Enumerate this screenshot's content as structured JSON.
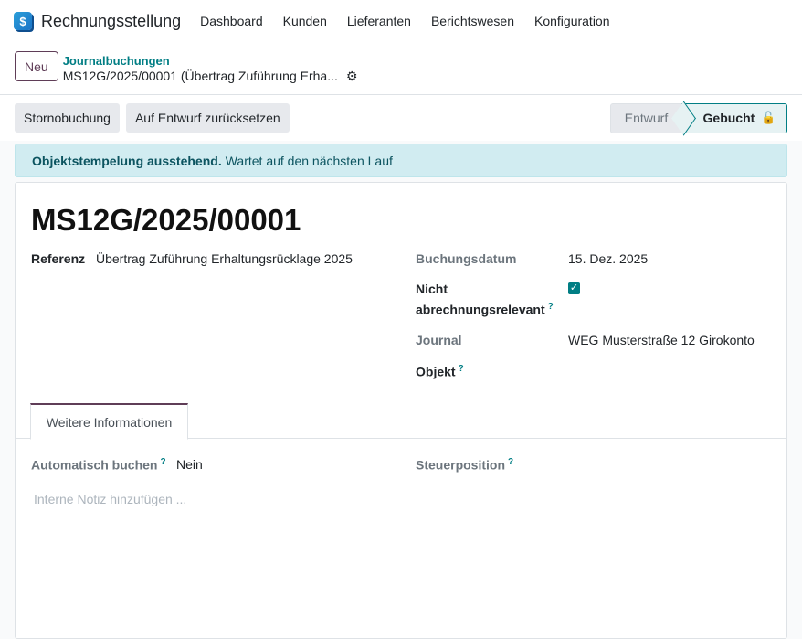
{
  "app": {
    "name": "Rechnungsstellung",
    "icon": "dollar-icon",
    "icon_glyph": "$"
  },
  "menu": [
    "Dashboard",
    "Kunden",
    "Lieferanten",
    "Berichtswesen",
    "Konfiguration"
  ],
  "control_panel": {
    "new_label": "Neu",
    "breadcrumb_parent": "Journalbuchungen",
    "breadcrumb_current": "MS12G/2025/00001 (Übertrag Zuführung Erha...",
    "gear_glyph": "⚙"
  },
  "statusbar": {
    "buttons": [
      "Stornobuchung",
      "Auf Entwurf zurücksetzen"
    ],
    "stages": [
      {
        "label": "Entwurf",
        "active": false
      },
      {
        "label": "Gebucht",
        "active": true
      }
    ],
    "lock_glyph": "🔓"
  },
  "alert": {
    "bold": "Objektstempelung ausstehend.",
    "text": "Wartet auf den nächsten Lauf"
  },
  "record": {
    "title": "MS12G/2025/00001",
    "ref_label": "Referenz",
    "ref_value": "Übertrag Zuführung Erhaltungsrücklage 2025",
    "date_label": "Buchungsdatum",
    "date_value": "15. Dez. 2025",
    "not_relevant_label_1": "Nicht",
    "not_relevant_label_2": "abrechnungsrelevant",
    "not_relevant_checked": true,
    "journal_label": "Journal",
    "journal_value": "WEG Musterstraße 12 Girokonto",
    "object_label": "Objekt",
    "help_glyph": "?"
  },
  "tabs": {
    "active": "Weitere Informationen"
  },
  "tab_content": {
    "auto_post_label": "Automatisch buchen",
    "auto_post_value": "Nein",
    "tax_position_label": "Steuerposition",
    "note_placeholder": "Interne Notiz hinzufügen ..."
  },
  "colors": {
    "primary": "#5f3d57",
    "accent": "#017e84",
    "alert_bg": "#d1ecf1"
  }
}
